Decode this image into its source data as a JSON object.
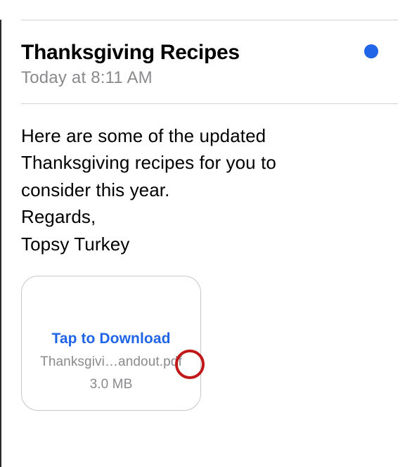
{
  "email": {
    "subject": "Thanksgiving Recipes",
    "timestamp": "Today at 8:11 AM",
    "body_line1": "Here are some of the updated",
    "body_line2": "Thanksgiving recipes for you to",
    "body_line3": "consider this year.",
    "body_line4": "Regards,",
    "body_line5": "Topsy Turkey"
  },
  "attachment": {
    "action_label": "Tap to Download",
    "filename": "Thanksgivi…andout.pdf",
    "size": "3.0 MB"
  }
}
